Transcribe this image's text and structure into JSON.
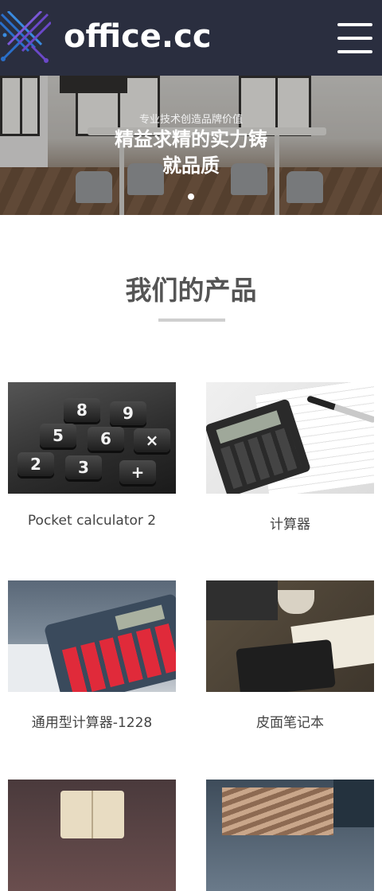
{
  "header": {
    "logo_text": "office.cc",
    "menu_icon": "hamburger-menu-icon"
  },
  "banner": {
    "subtitle": "专业技术创造品牌价值",
    "title_line1": "精益求精的实力铸",
    "title_line2": "就品质",
    "slide_count": 1,
    "active_slide": 1
  },
  "products_section": {
    "title": "我们的产品",
    "items": [
      {
        "name": "Pocket calculator 2"
      },
      {
        "name": "计算器"
      },
      {
        "name": "通用型计算器-1228"
      },
      {
        "name": "皮面笔记本"
      },
      {
        "name": ""
      },
      {
        "name": ""
      }
    ]
  },
  "colors": {
    "header_bg": "#2a2e3f",
    "logo_blue": "#2a6fc9",
    "logo_purple": "#6b48c8",
    "title_text": "#555555",
    "divider": "#cfcfcf"
  }
}
